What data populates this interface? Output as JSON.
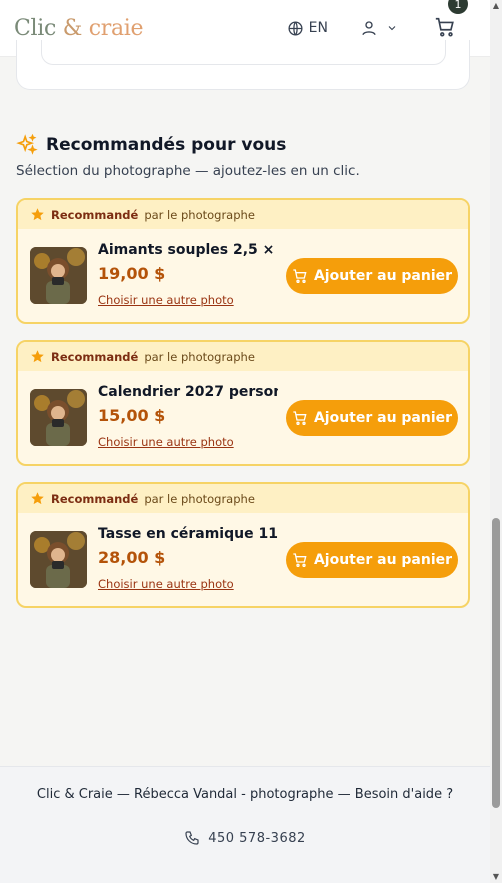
{
  "header": {
    "logo_clic": "Clic",
    "logo_amp": " & ",
    "logo_craie": "craie",
    "lang_label": "EN",
    "cart_count": "1"
  },
  "recommended": {
    "title": "Recommandés pour vous",
    "subtitle": "Sélection du photographe — ajoutez-les en un clic.",
    "badge_bold": "Recommandé",
    "badge_rest": "par le photographe",
    "items": [
      {
        "name": "Aimants souples 2,5 × ...",
        "price": "19,00 $",
        "alt_link": "Choisir une autre photo",
        "button": "Ajouter au panier"
      },
      {
        "name": "Calendrier 2027 person...",
        "price": "15,00 $",
        "alt_link": "Choisir une autre photo",
        "button": "Ajouter au panier"
      },
      {
        "name": "Tasse en céramique 11 ...",
        "price": "28,00 $",
        "alt_link": "Choisir une autre photo",
        "button": "Ajouter au panier"
      }
    ]
  },
  "footer": {
    "line": "Clic & Craie — Rébecca Vandal - photographe — Besoin d'aide ?",
    "phone": "450 578-3682"
  },
  "colors": {
    "accent": "#f59e0b",
    "price": "#b45309",
    "card_bg": "#fff8e6",
    "card_border": "#f6d365"
  }
}
